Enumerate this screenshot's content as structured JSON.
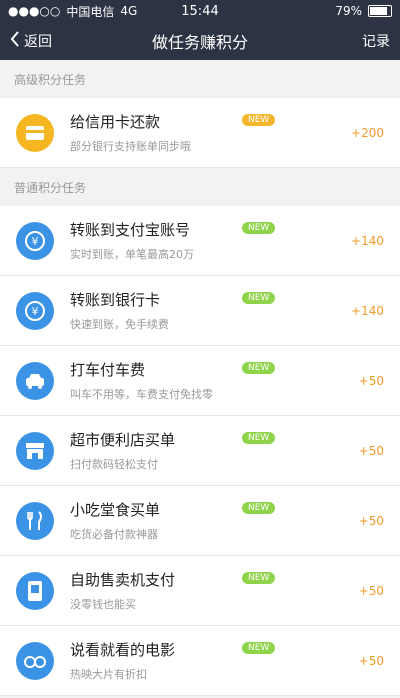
{
  "status": {
    "carrier": "中国电信",
    "network": "4G",
    "time": "15:44",
    "battery": "79%",
    "battery_level": 0.79
  },
  "nav": {
    "back_label": "返回",
    "title": "做任务赚积分",
    "record_label": "记录"
  },
  "advanced": {
    "header": "高级积分任务",
    "items": [
      {
        "name": "给信用卡还款",
        "desc": "部分银行支持账单同步哦",
        "badge": "NEW",
        "points": "+200",
        "icon": "card-icon",
        "color": "#f5b622"
      }
    ]
  },
  "normal": {
    "header": "普通积分任务",
    "items": [
      {
        "name": "转账到支付宝账号",
        "desc": "实时到账，单笔最高20万",
        "badge": "NEW",
        "points": "+140",
        "icon": "transfer-yuan-icon",
        "color": "#3b93e6"
      },
      {
        "name": "转账到银行卡",
        "desc": "快速到账，免手续费",
        "badge": "NEW",
        "points": "+140",
        "icon": "transfer-yuan-icon",
        "color": "#3b93e6"
      },
      {
        "name": "打车付车费",
        "desc": "叫车不用等，车费支付免找零",
        "badge": "NEW",
        "points": "+50",
        "icon": "car-icon",
        "color": "#3b93e6"
      },
      {
        "name": "超市便利店买单",
        "desc": "扫付款码轻松支付",
        "badge": "NEW",
        "points": "+50",
        "icon": "store-icon",
        "color": "#3b93e6"
      },
      {
        "name": "小吃堂食买单",
        "desc": "吃货必备付款神器",
        "badge": "NEW",
        "points": "+50",
        "icon": "fork-knife-icon",
        "color": "#3b93e6"
      },
      {
        "name": "自助售卖机支付",
        "desc": "没零钱也能买",
        "badge": "NEW",
        "points": "+50",
        "icon": "vending-icon",
        "color": "#3b93e6"
      },
      {
        "name": "说看就看的电影",
        "desc": "热映大片有折扣",
        "badge": "NEW",
        "points": "+50",
        "icon": "glasses-icon",
        "color": "#3b93e6"
      }
    ]
  }
}
